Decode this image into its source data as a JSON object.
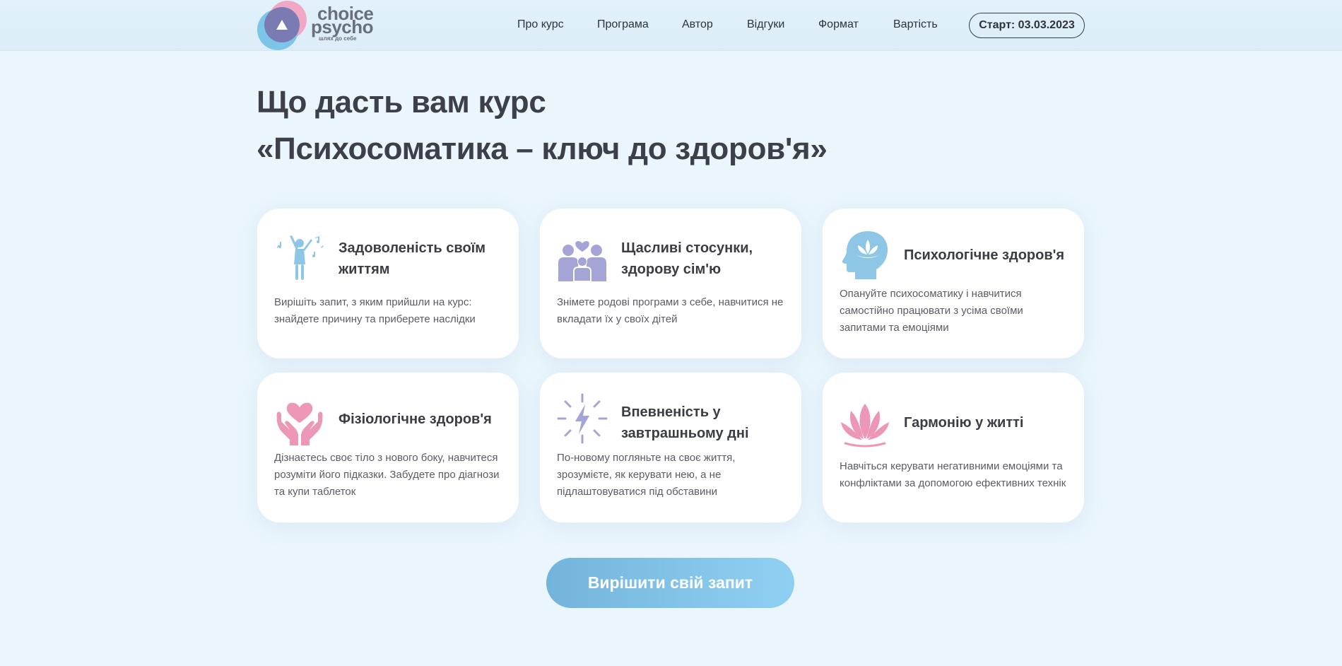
{
  "brand": {
    "name_line1": "choice",
    "name_line2": "psycho",
    "tagline": "шлях до себе"
  },
  "nav": {
    "items": [
      {
        "label": "Про курс"
      },
      {
        "label": "Програма"
      },
      {
        "label": "Автор"
      },
      {
        "label": "Відгуки"
      },
      {
        "label": "Формат"
      },
      {
        "label": "Вартість"
      }
    ],
    "start_label": "Старт: 03.03.2023"
  },
  "section": {
    "title_line1": "Що дасть вам курс",
    "title_line2": "«Психосоматика – ключ до здоров'я»"
  },
  "cards": [
    {
      "icon": "dancing-person-icon",
      "title": "Задоволеність своїм життям",
      "text": "Вирішіть запит, з яким прийшли на курс: знайдете причину та приберете наслідки"
    },
    {
      "icon": "family-icon",
      "title": "Щасливі стосунки, здорову сім'ю",
      "text": "Знімете родові програми з себе, навчитися не вкладати їх у своїх дітей"
    },
    {
      "icon": "head-lotus-icon",
      "title": "Психологічне здоров'я",
      "text": "Опануйте психосоматику і навчитися самостійно працювати з усіма своїми запитами та емоціями"
    },
    {
      "icon": "hands-heart-icon",
      "title": "Фізіологічне здоров'я",
      "text": "Дізнаєтесь своє тіло з нового боку, навчитеся розуміти його підказки. Забудете про діагнози та купи таблеток"
    },
    {
      "icon": "lightning-icon",
      "title": "Впевненість у завтрашньому дні",
      "text": "По-новому погляньте на своє життя, зрозумієте, як керувати нею, а не підлаштовуватися під обставини"
    },
    {
      "icon": "lotus-icon",
      "title": "Гармонію у житті",
      "text": "Навчіться керувати негативними емоціями та конфліктами за допомогою ефективних технік"
    }
  ],
  "cta": {
    "label": "Вирішити свій запит"
  },
  "colors": {
    "background": "#eaf5fc",
    "blue_icon": "#8ec6e6",
    "purple_icon": "#a4a4d6",
    "pink_icon": "#ec97b6",
    "cta_start": "#74b4dc",
    "cta_end": "#8fd0f2",
    "text_dark": "#3d4048"
  }
}
